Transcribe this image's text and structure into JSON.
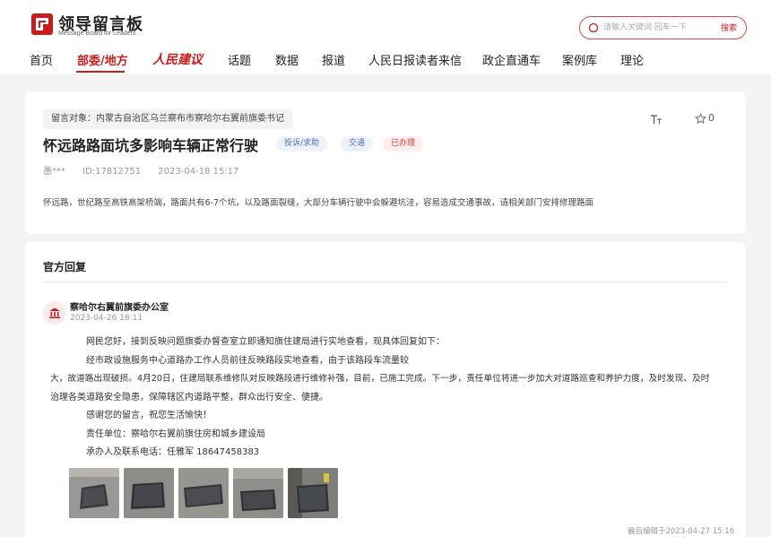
{
  "header": {
    "logo_title": "领导留言板",
    "logo_subtitle": "Message Board for Leaders",
    "search_placeholder": "请输入关键词 回车一下",
    "search_button": "搜索"
  },
  "nav": {
    "items": [
      {
        "label": "首页"
      },
      {
        "label": "部委/地方"
      },
      {
        "label": "人民建议"
      },
      {
        "label": "话题"
      },
      {
        "label": "数据"
      },
      {
        "label": "报道"
      },
      {
        "label": "人民日报读者来信"
      },
      {
        "label": "政企直通车"
      },
      {
        "label": "案例库"
      },
      {
        "label": "理论"
      }
    ],
    "active_index": 1
  },
  "message": {
    "target": "留言对象：内蒙古自治区乌兰察布市察哈尔右翼前旗委书记",
    "star_count": "0",
    "title": "怀远路路面坑多影响车辆正常行驶",
    "tag_type": "投诉/求助",
    "tag_domain": "交通",
    "tag_status": "已办理",
    "author": "愚***",
    "id": "ID:17812751",
    "time": "2023-04-18 15:17",
    "content": "怀远路，世纪路至高铁高架桥端，路面共有6-7个坑，以及路面裂缝，大部分车辆行驶中会躲避坑洼，容易造成交通事故，请相关部门安排修理路面"
  },
  "reply": {
    "heading": "官方回复",
    "org": "察哈尔右翼前旗委办公室",
    "time": "2023-04-26 18:11",
    "lines": [
      "网民您好，接到反映问题旗委办督查室立即通知旗住建局进行实地查看，现具体回复如下：",
      "经市政设施服务中心道路办工作人员前往反映路段实地查看，由于该路段车流量较",
      "大，故道路出现破损。4月20日，住建局联系维修队对反映路段进行维修补强，目前，已施工完成。下一步，责任单位将进一步加大对道路巡查和养护力度，及时发现、及时",
      "治理各类道路安全隐患，保障辖区内道路平整，群众出行安全、便捷。",
      "感谢您的留言，祝您生活愉快！",
      "责任单位：察哈尔右翼前旗住房和城乡建设局",
      "承办人及联系电话：任雅军  18647458383"
    ],
    "edited": "最后编辑于2023-04-27 15:16"
  },
  "colors": {
    "brand_red": "#c71d1d",
    "chip_blue": "#4d6fb5",
    "chip_red": "#d53a3a"
  }
}
